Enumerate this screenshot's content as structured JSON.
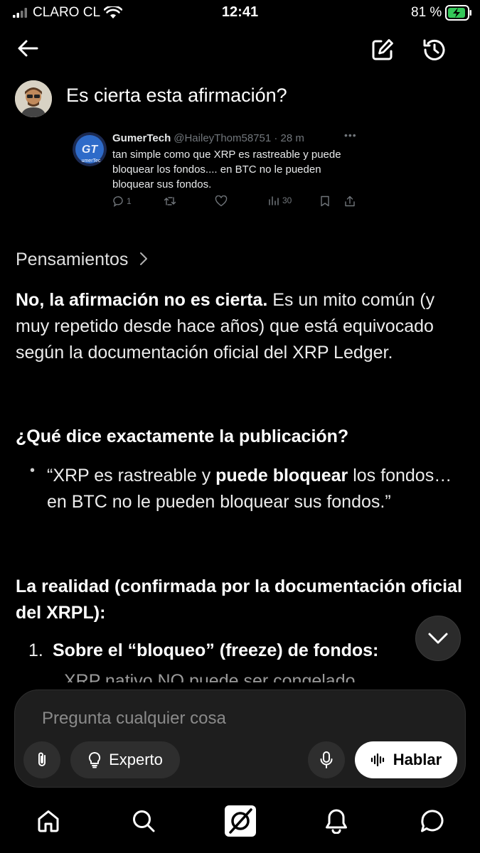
{
  "status_bar": {
    "carrier": "CLARO CL",
    "time": "12:41",
    "battery": "81 %"
  },
  "header": {
    "back_icon": "arrow-left-icon",
    "edit_icon": "compose-icon",
    "history_icon": "history-icon"
  },
  "chat": {
    "title": "Es cierta esta afirmación?"
  },
  "tweet": {
    "author": "GumerTech",
    "handle": "@HaileyThom58751 · 28 m",
    "text": "tan simple como que XRP es rastreable y puede bloquear los fondos.... en BTC no le pueden bloquear sus fondos.",
    "replies": "1",
    "views": "30",
    "avatar_text": "GT",
    "avatar_subtext": "umerTec"
  },
  "response": {
    "thoughts_label": "Pensamientos",
    "intro_bold": "No, la afirmación no es cierta.",
    "intro_rest": " Es un mito común (y muy repetido desde hace años) que está equivocado según la documentación oficial del XRP Ledger.",
    "h_publication": "¿Qué dice exactamente la publicación?",
    "quote_pre": "“XRP es rastreable y ",
    "quote_bold": "puede bloquear",
    "quote_post": " los fondos… en BTC no le pueden bloquear sus fondos.”",
    "h_reality": "La realidad (confirmada por la documentación oficial del XRPL):",
    "item1_number": "1.",
    "item1_bold": "Sobre el “bloqueo” (freeze) de fondos:",
    "cutoff_text": "XRP nativo NO puede ser congelado"
  },
  "composer": {
    "placeholder": "Pregunta cualquier cosa",
    "mode_label": "Experto",
    "speak_label": "Hablar"
  },
  "bottom_nav": {
    "items": [
      "home-icon",
      "search-icon",
      "grok-icon",
      "notifications-icon",
      "messages-icon"
    ]
  },
  "colors": {
    "background": "#000000",
    "composer_bg": "#1e1e1e",
    "battery_green": "#34c759"
  }
}
